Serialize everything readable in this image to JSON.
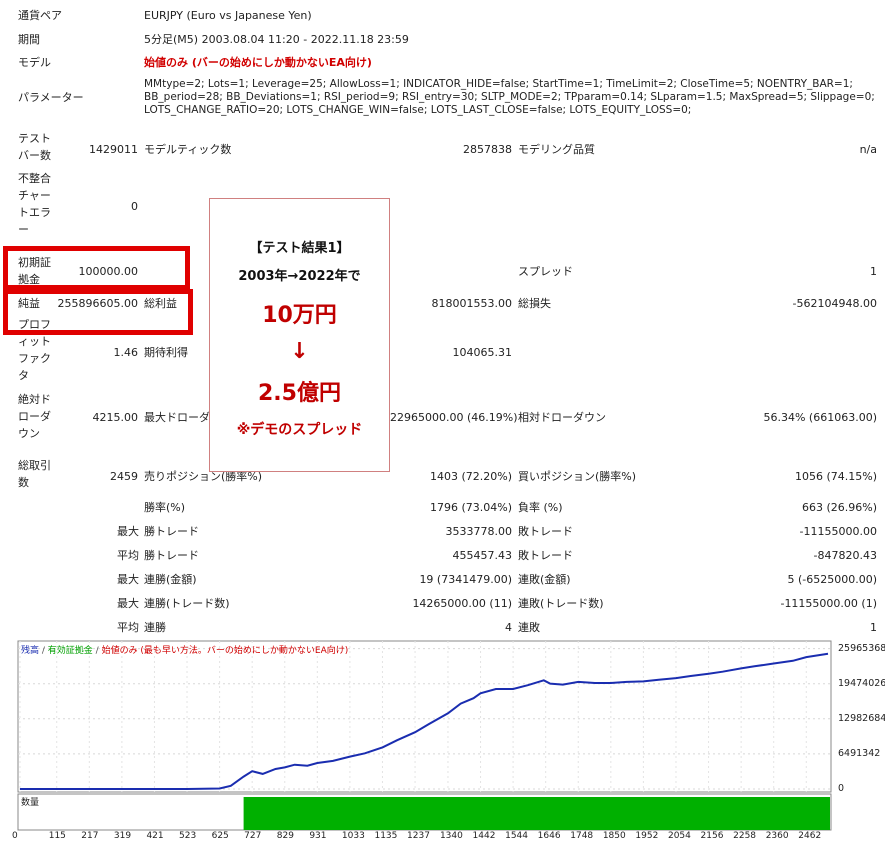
{
  "report": {
    "pair_label": "通貨ペア",
    "pair_value": "EURJPY (Euro vs Japanese Yen)",
    "period_label": "期間",
    "period_value": "5分足(M5) 2003.08.04 11:20 - 2022.11.18 23:59",
    "model_label": "モデル",
    "model_value": "始値のみ (バーの始めにしか動かないEA向け)",
    "params_label": "パラメーター",
    "params_line1": "MMtype=2; Lots=1; Leverage=25; AllowLoss=1; INDICATOR_HIDE=false; StartTime=1; TimeLimit=2; CloseTime=5; NOENTRY_BAR=1;",
    "params_line2": "BB_period=28; BB_Deviations=1; RSI_period=9; RSI_entry=30; SLTP_MODE=2; TPparam=0.14; SLparam=1.5; MaxSpread=5; Slippage=0;",
    "params_line3": "LOTS_CHANGE_RATIO=20; LOTS_CHANGE_WIN=false; LOTS_LAST_CLOSE=false; LOTS_EQUITY_LOSS=0;",
    "bars_label": "テスト\nバー数",
    "bars_value": "1429011",
    "ticks_label": "モデルティック数",
    "ticks_value": "2857838",
    "quality_label": "モデリング品質",
    "quality_value": "n/a",
    "mismatch_label": "不整合\nチャー\nトエラ\nー",
    "mismatch_value": "0",
    "deposit_label": "初期証\n拠金",
    "deposit_value": "100000.00",
    "spread_label": "スプレッド",
    "spread_value": "1",
    "net_label": "純益",
    "net_value": "255896605.00",
    "gross_profit_label": "総利益",
    "gross_profit_value": "818001553.00",
    "gross_loss_label": "総損失",
    "gross_loss_value": "-562104948.00",
    "pf_label": "プロフ\nィット\nファク\nタ",
    "pf_value": "1.46",
    "expected_label": "期待利得",
    "expected_value": "104065.31",
    "abs_dd_label": "絶対ド\nローダ\nウン",
    "abs_dd_value": "4215.00",
    "max_dd_label": "最大ドローダ",
    "max_dd_value": "22965000.00 (46.19%)",
    "rel_dd_label": "相対ドローダウン",
    "rel_dd_value": "56.34% (661063.00)",
    "total_trades_label": "総取引\n数",
    "total_trades_value": "2459",
    "short_label": "売りポジション(勝率%)",
    "short_value": "1403 (72.20%)",
    "long_label": "買いポジション(勝率%)",
    "long_value": "1056 (74.15%)",
    "winrate_label": "勝率(%)",
    "winrate_value": "1796 (73.04%)",
    "lossrate_label": "負率 (%)",
    "lossrate_value": "663 (26.96%)",
    "max_label": "最大",
    "avg_label": "平均",
    "win_trade_label": "勝トレード",
    "loss_trade_label": "敗トレード",
    "max_win_value": "3533778.00",
    "max_loss_value": "-11155000.00",
    "avg_win_value": "455457.43",
    "avg_loss_value": "-847820.43",
    "consec_win_amt_label": "連勝(金額)",
    "consec_win_amt_value": "19 (7341479.00)",
    "consec_loss_amt_label": "連敗(金額)",
    "consec_loss_amt_value": "5 (-6525000.00)",
    "consec_win_cnt_label": "連勝(トレード数)",
    "consec_win_cnt_value": "14265000.00 (11)",
    "consec_loss_cnt_label": "連敗(トレード数)",
    "consec_loss_cnt_value": "-11155000.00 (1)",
    "avg_consec_win_label": "連勝",
    "avg_consec_win_value": "4",
    "avg_consec_loss_label": "連敗",
    "avg_consec_loss_value": "1"
  },
  "callout": {
    "line1": "【テスト結果1】",
    "line2": "2003年→2022年で",
    "line3": "10万円",
    "arrow": "↓",
    "line4": "2.5億円",
    "line5": "※デモのスプレッド"
  },
  "chart_data": {
    "type": "line",
    "legend_balance": "残高",
    "legend_equity": "有効証拠金",
    "legend_model": "始値のみ (最も早い方法。バーの始めにしか動かないEA向け)",
    "volume_label": "数量",
    "y_ticks": [
      "25965368",
      "19474026",
      "12982684",
      "6491342",
      "0"
    ],
    "x_ticks": [
      "0",
      "115",
      "217",
      "319",
      "421",
      "523",
      "625",
      "727",
      "829",
      "931",
      "1033",
      "1135",
      "1237",
      "1340",
      "1442",
      "1544",
      "1646",
      "1748",
      "1850",
      "1952",
      "2054",
      "2156",
      "2258",
      "2360",
      "2462"
    ],
    "ylim": [
      0,
      27000000
    ],
    "xlim": [
      0,
      2530
    ],
    "x": [
      0,
      115,
      217,
      319,
      421,
      523,
      625,
      660,
      700,
      727,
      760,
      800,
      829,
      860,
      900,
      931,
      980,
      1033,
      1080,
      1135,
      1180,
      1237,
      1280,
      1340,
      1380,
      1420,
      1442,
      1490,
      1544,
      1590,
      1640,
      1660,
      1700,
      1748,
      1800,
      1850,
      1900,
      1952,
      2000,
      2054,
      2100,
      2156,
      2200,
      2258,
      2300,
      2360,
      2420,
      2462,
      2530
    ],
    "values": [
      0,
      0,
      0,
      0,
      0,
      0,
      100000,
      600000,
      2300000,
      3300000,
      2800000,
      3700000,
      4000000,
      4500000,
      4300000,
      4800000,
      5200000,
      6000000,
      6600000,
      7700000,
      9000000,
      10500000,
      12000000,
      14000000,
      15800000,
      16800000,
      17700000,
      18500000,
      18500000,
      19200000,
      20100000,
      19500000,
      19300000,
      19800000,
      19600000,
      19600000,
      19800000,
      19900000,
      20200000,
      20500000,
      20900000,
      21300000,
      21700000,
      22300000,
      22700000,
      23200000,
      23700000,
      24400000,
      25000000
    ],
    "colors": {
      "balance": "#1a2db0",
      "equity": "#00b000",
      "volume": "#00b000",
      "model": "#d00000"
    }
  }
}
